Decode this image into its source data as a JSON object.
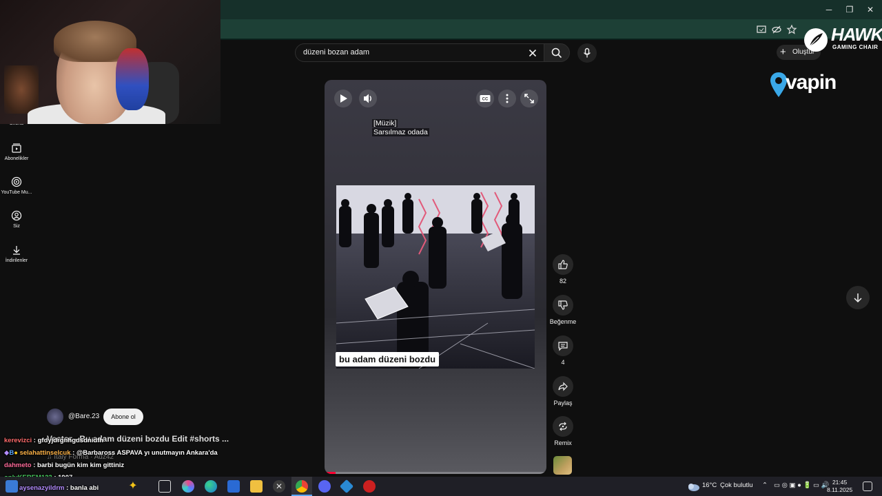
{
  "search": {
    "query": "düzeni bozan adam"
  },
  "header": {
    "create_label": "Oluştur"
  },
  "brand": {
    "hawk_title": "HAWK",
    "hawk_subtitle": "GAMING CHAIR",
    "vapin": "vapin"
  },
  "left_nav": {
    "items": [
      {
        "label": "Shorts",
        "icon": "shorts-icon"
      },
      {
        "label": "Abonelikler",
        "icon": "subscriptions-icon"
      },
      {
        "label": "YouTube Mu...",
        "icon": "youtube-music-icon"
      },
      {
        "label": "Siz",
        "icon": "account-icon"
      },
      {
        "label": "İndirilenler",
        "icon": "download-icon"
      }
    ]
  },
  "video": {
    "subtitle_line1": "[Müzik]",
    "subtitle_line2": "Sarsılmaz odada",
    "caption": "bu adam düzeni bozdu",
    "progress": 0.05
  },
  "actions": {
    "like_count": "82",
    "dislike_label": "Beğenme",
    "comment_count": "4",
    "share_label": "Paylaş",
    "remix_label": "Remix"
  },
  "channel": {
    "name": "@Bare.23",
    "subscribe_label": "Abone ol",
    "video_title": "Vector - Bu adam düzeni bozdu Edit #shorts ...",
    "music": "♫ Italy Forma · Adz42"
  },
  "chat": [
    {
      "user": "kerevizci",
      "message": ": gfdyjdrgnhgdsdnidfh",
      "color": "#ff6b6b"
    },
    {
      "user": "selahattinselcuk",
      "message": ": @Barbaross ASPAVA yı unutmayın Ankara'da",
      "color": "#ffb347"
    },
    {
      "user": "dahmeto",
      "message": ": barbi bugün kim kim gittiniz",
      "color": "#ff6b9a"
    },
    {
      "user": "onlyKEREM123",
      "message": ": 1907",
      "color": "#4cd964"
    },
    {
      "user": "aysenazyildrm",
      "message": ": banla abi",
      "color": "#b48cff"
    }
  ],
  "taskbar": {
    "temperature": "16°C",
    "weather": "Çok bulutlu",
    "time": "21:45",
    "date": "8.11.2025"
  },
  "colors": {
    "accent_red": "#ff0033",
    "chrome_green": "#1d4036",
    "page_bg": "#0f0f0f"
  }
}
